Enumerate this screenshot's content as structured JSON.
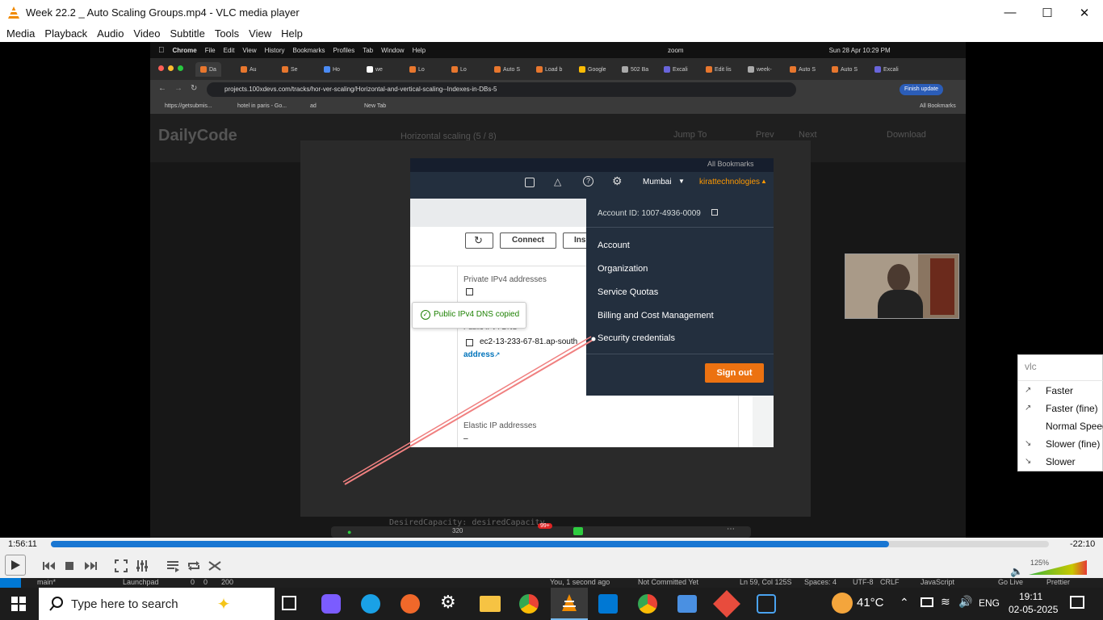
{
  "window": {
    "title": "Week 22.2 _ Auto Scaling Groups.mp4 - VLC media player"
  },
  "menu": [
    "Media",
    "Playback",
    "Audio",
    "Video",
    "Subtitle",
    "Tools",
    "View",
    "Help"
  ],
  "mac": {
    "menubar": [
      "Chrome",
      "File",
      "Edit",
      "View",
      "History",
      "Bookmarks",
      "Profiles",
      "Tab",
      "Window",
      "Help"
    ],
    "clock": "Sun 28 Apr  10:29 PM",
    "zoom_label": "zoom",
    "tabs": [
      "Da",
      "Au",
      "Se",
      "Ho",
      "we",
      "Lo",
      "Lo",
      "Auto S",
      "Load b",
      "Google",
      "502 Ba",
      "Excali",
      "Edit lis",
      "week-",
      "Auto S",
      "Auto S",
      "Excali"
    ],
    "url": "projects.100xdevs.com/tracks/hor-ver-scaling/Horizontal-and-vertical-scaling--Indexes-in-DBs-5",
    "finish_update": "Finish update",
    "bookmarks": [
      "https://getsubmis...",
      "hotel in paris - Go...",
      "ad",
      "New Tab"
    ],
    "all_bookmarks": "All Bookmarks"
  },
  "dailycode": {
    "logo": "DailyCode",
    "lesson": "Horizontal scaling (5 / 8)",
    "jump": "Jump To",
    "prev": "Prev",
    "next": "Next",
    "download": "Download",
    "code": "DesiredCapacity: desiredCapacity"
  },
  "aws": {
    "all_bookmarks": "All Bookmarks",
    "region": "Mumbai",
    "account_name": "kirattechnologies",
    "account_id": "Account ID: 1007-4936-0009",
    "connect": "Connect",
    "ins": "Ins",
    "private_ipv4": "Private IPv4 addresses",
    "toast": "Public IPv4 DNS copied",
    "dns_label": "Public IPv4 DNS",
    "dns_value": "ec2-13-233-67-81.ap-south",
    "address": "address",
    "elastic_ip": "Elastic IP addresses",
    "elastic_value": "–",
    "dropdown": [
      "Account",
      "Organization",
      "Service Quotas",
      "Billing and Cost Management",
      "Security credentials"
    ],
    "sign_out": "Sign out"
  },
  "meeting_toolbar": {
    "badge": "99+",
    "video_res": "320"
  },
  "player": {
    "elapsed": "1:56:11",
    "remaining": "-22:10",
    "progress": 0.84,
    "volume_label": "125%",
    "volume": 1.25
  },
  "speed_menu": {
    "search": "vlc",
    "items": [
      "Faster",
      "Faster (fine)",
      "Normal Speed",
      "Slower (fine)",
      "Slower"
    ]
  },
  "vscode_status": {
    "branch": "main*",
    "launchpad": "Launchpad",
    "errors": "0",
    "warnings": "0",
    "ports": "200",
    "blame": "You, 1 second ago",
    "not_committed": "Not Committed Yet",
    "position": "Ln 59, Col 125S",
    "spaces": "Spaces: 4",
    "encoding": "UTF-8",
    "eol": "CRLF",
    "language": "JavaScript",
    "golive": "Go Live",
    "prettier": "Prettier"
  },
  "taskbar": {
    "search_placeholder": "Type here to search",
    "weather": "41°C",
    "lang": "ENG",
    "time": "19:11",
    "date": "02-05-2025"
  }
}
